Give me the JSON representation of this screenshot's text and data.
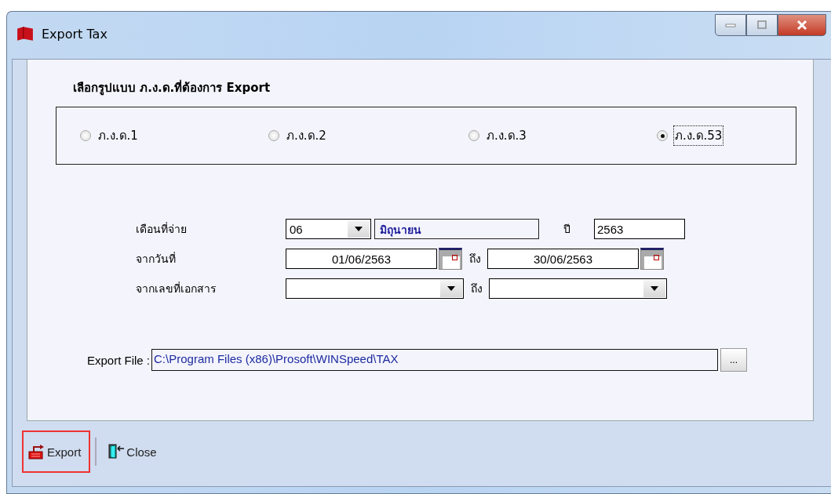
{
  "window": {
    "title": "Export Tax"
  },
  "group": {
    "label": "เลือกรูปแบบ ภ.ง.ด.ที่ต้องการ Export",
    "options": [
      {
        "label": "ภ.ง.ด.1",
        "selected": false
      },
      {
        "label": "ภ.ง.ด.2",
        "selected": false
      },
      {
        "label": "ภ.ง.ด.3",
        "selected": false
      },
      {
        "label": "ภ.ง.ด.53",
        "selected": true
      }
    ]
  },
  "month": {
    "label": "เดือนที่จ่าย",
    "value": "06",
    "name": "มิถุนายน",
    "year_label": "ปี",
    "year": "2563"
  },
  "date_range": {
    "label": "จากวันที่",
    "from": "01/06/2563",
    "to_label": "ถึง",
    "to": "30/06/2563"
  },
  "doc_range": {
    "label": "จากเลขที่เอกสาร",
    "to_label": "ถึง"
  },
  "export_file": {
    "label": "Export File :",
    "value": "C:\\Program Files (x86)\\Prosoft\\WINSpeed\\TAX",
    "browse": "..."
  },
  "toolbar": [
    {
      "kind": "export",
      "label": "Export",
      "highlighted": true
    },
    {
      "kind": "close",
      "label": "Close",
      "highlighted": false
    }
  ]
}
